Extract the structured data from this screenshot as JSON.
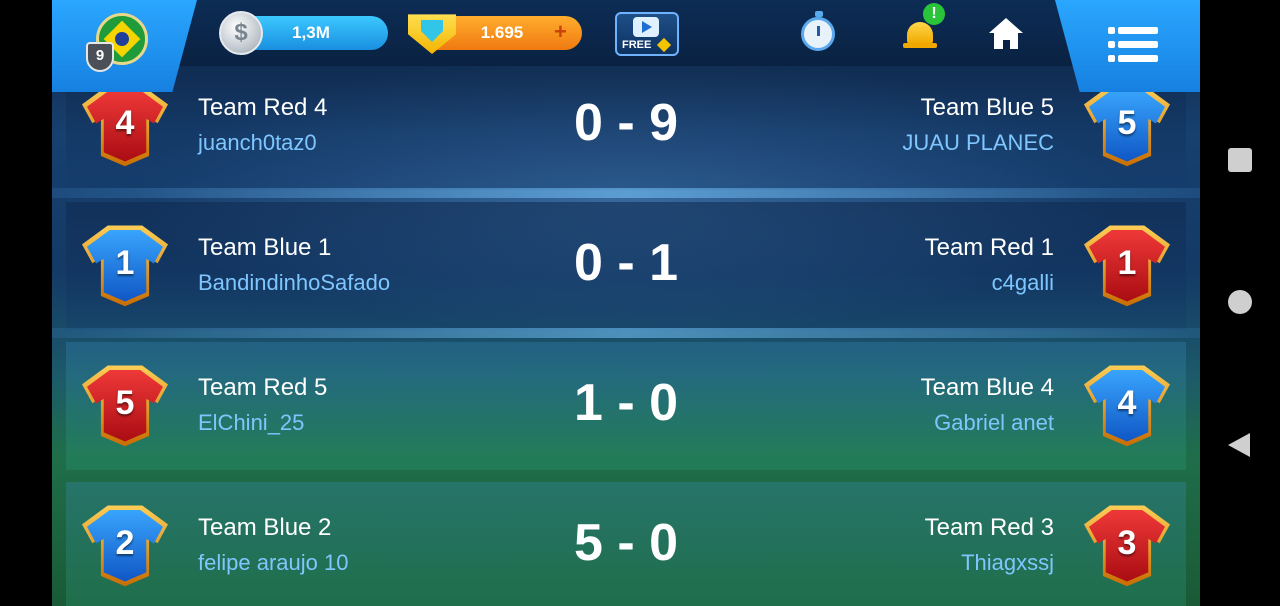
{
  "header": {
    "level": "9",
    "coins": "1,3M",
    "gems": "1.695",
    "gems_plus": "+",
    "free_video_label": "FREE",
    "notification_badge": "!",
    "coin_symbol": "$"
  },
  "matches": [
    {
      "home_team": "Team Red 4",
      "home_player": "juanch0taz0",
      "home_number": "4",
      "home_color": "red",
      "score": "0 - 9",
      "away_team": "Team Blue 5",
      "away_player": "JUAU PLANEC",
      "away_number": "5",
      "away_color": "blue"
    },
    {
      "home_team": "Team Blue 1",
      "home_player": "BandindinhoSafado",
      "home_number": "1",
      "home_color": "blue",
      "score": "0 - 1",
      "away_team": "Team Red 1",
      "away_player": "c4galli",
      "away_number": "1",
      "away_color": "red"
    },
    {
      "home_team": "Team Red 5",
      "home_player": "ElChini_25",
      "home_number": "5",
      "home_color": "red",
      "score": "1 - 0",
      "away_team": "Team Blue 4",
      "away_player": "Gabriel anet",
      "away_number": "4",
      "away_color": "blue"
    },
    {
      "home_team": "Team Blue 2",
      "home_player": "felipe araujo 10",
      "home_number": "2",
      "home_color": "blue",
      "score": "5 - 0",
      "away_team": "Team Red 3",
      "away_player": "Thiagxssj",
      "away_number": "3",
      "away_color": "red"
    }
  ],
  "colors": {
    "red_kit": "#e0202a",
    "blue_kit": "#1f7fe8",
    "player_name": "#7fc6ff",
    "coins_pill": "#29aef5",
    "gems_pill": "#f7921e"
  },
  "icons": [
    "brazil-flag-icon",
    "level-shield-icon",
    "coin-icon",
    "gem-icon",
    "free-video-icon",
    "stopwatch-icon",
    "bell-icon",
    "home-icon",
    "menu-list-icon"
  ]
}
